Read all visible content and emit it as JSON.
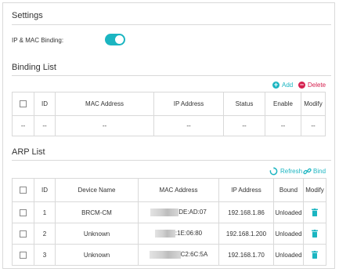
{
  "settings": {
    "title": "Settings",
    "ip_mac_binding_label": "IP & MAC Binding:",
    "ip_mac_binding_enabled": true
  },
  "binding_list": {
    "title": "Binding List",
    "add_label": "Add",
    "delete_label": "Delete",
    "columns": [
      "ID",
      "MAC Address",
      "IP Address",
      "Status",
      "Enable",
      "Modify"
    ],
    "empty_row": [
      "--",
      "--",
      "--",
      "--",
      "--",
      "--",
      "--"
    ]
  },
  "arp_list": {
    "title": "ARP List",
    "refresh_label": "Refresh",
    "bind_label": "Bind",
    "columns": [
      "ID",
      "Device Name",
      "MAC Address",
      "IP Address",
      "Bound",
      "Modify"
    ],
    "rows": [
      {
        "id": "1",
        "device": "BRCM-CM",
        "mac": "DE:AD:07",
        "ip": "192.168.1.86",
        "bound": "Unloaded"
      },
      {
        "id": "2",
        "device": "Unknown",
        "mac": ":1E:06:80",
        "ip": "192.168.1.200",
        "bound": "Unloaded"
      },
      {
        "id": "3",
        "device": "Unknown",
        "mac": "C2:6C:5A",
        "ip": "192.168.1.70",
        "bound": "Unloaded"
      }
    ]
  },
  "colors": {
    "accent": "#1bb5c1",
    "delete": "#d6204f"
  }
}
